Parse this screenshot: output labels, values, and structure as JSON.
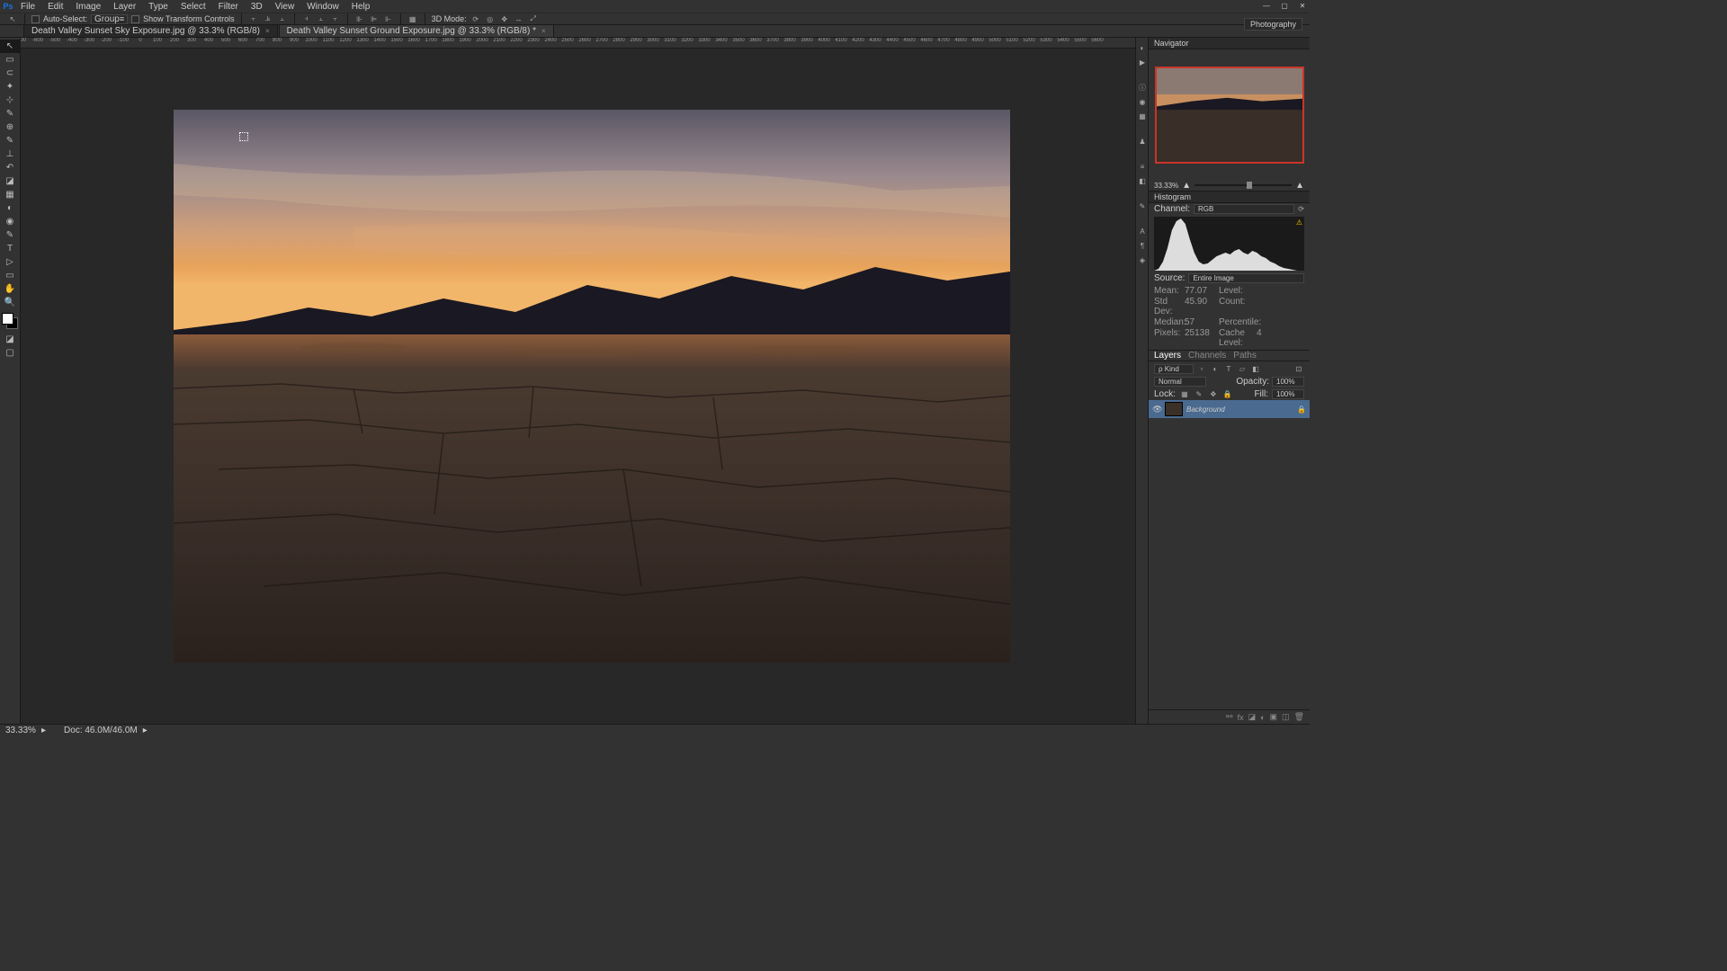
{
  "menubar": {
    "items": [
      "File",
      "Edit",
      "Image",
      "Layer",
      "Type",
      "Select",
      "Filter",
      "3D",
      "View",
      "Window",
      "Help"
    ]
  },
  "optbar": {
    "autoSelect": "Auto-Select:",
    "group": "Group",
    "showTransform": "Show Transform Controls",
    "mode3d": "3D Mode:"
  },
  "workspace": "Photography",
  "tabs": [
    {
      "label": "Death Valley Sunset Sky Exposure.jpg @ 33.3% (RGB/8)",
      "active": true
    },
    {
      "label": "Death Valley Sunset Ground Exposure.jpg @ 33.3% (RGB/8) *",
      "active": false
    }
  ],
  "tools": [
    "↖",
    "▭",
    "◯",
    "✎",
    "⊹",
    "⟋",
    "✂",
    "✎",
    "⟋",
    "✣",
    "⟋",
    "▦",
    "◐",
    "◉",
    "✎",
    "≡",
    "T",
    "▷",
    "⬡",
    "✋",
    "🔍"
  ],
  "hruler": [
    "-700",
    "-600",
    "-500",
    "-400",
    "-300",
    "-200",
    "-100",
    "0",
    "100",
    "200",
    "300",
    "400",
    "500",
    "600",
    "700",
    "800",
    "900",
    "1000",
    "1100",
    "1200",
    "1300",
    "1400",
    "1500",
    "1600",
    "1700",
    "1800",
    "1900",
    "2000",
    "2100",
    "2200",
    "2300",
    "2400",
    "2500",
    "2600",
    "2700",
    "2800",
    "2900",
    "3000",
    "3100",
    "3200",
    "3300",
    "3400",
    "3500",
    "3600",
    "3700",
    "3800",
    "3900",
    "4000",
    "4100",
    "4200",
    "4300",
    "4400",
    "4500",
    "4600",
    "4700",
    "4800",
    "4900",
    "5000",
    "5100",
    "5200",
    "5300",
    "5400",
    "5500",
    "5600"
  ],
  "navigator": {
    "title": "Navigator",
    "zoom": "33.33%"
  },
  "histogram": {
    "title": "Histogram",
    "channelLabel": "Channel:",
    "channel": "RGB",
    "sourceLabel": "Source:",
    "source": "Entire Image",
    "stats": {
      "Mean": "77.07",
      "StdDev": "45.90",
      "Median": "57",
      "Pixels": "25138",
      "Level": "",
      "Count": "",
      "Percentile": "",
      "CacheLevel": "4"
    }
  },
  "layers": {
    "tabs": [
      "Layers",
      "Channels",
      "Paths"
    ],
    "kind": "ρ Kind",
    "blend": "Normal",
    "opacityLabel": "Opacity:",
    "opacity": "100%",
    "lockLabel": "Lock:",
    "fillLabel": "Fill:",
    "fill": "100%",
    "layer": {
      "name": "Background"
    }
  },
  "statusbar": {
    "zoom": "33.33%",
    "doc": "Doc: 46.0M/46.0M"
  }
}
